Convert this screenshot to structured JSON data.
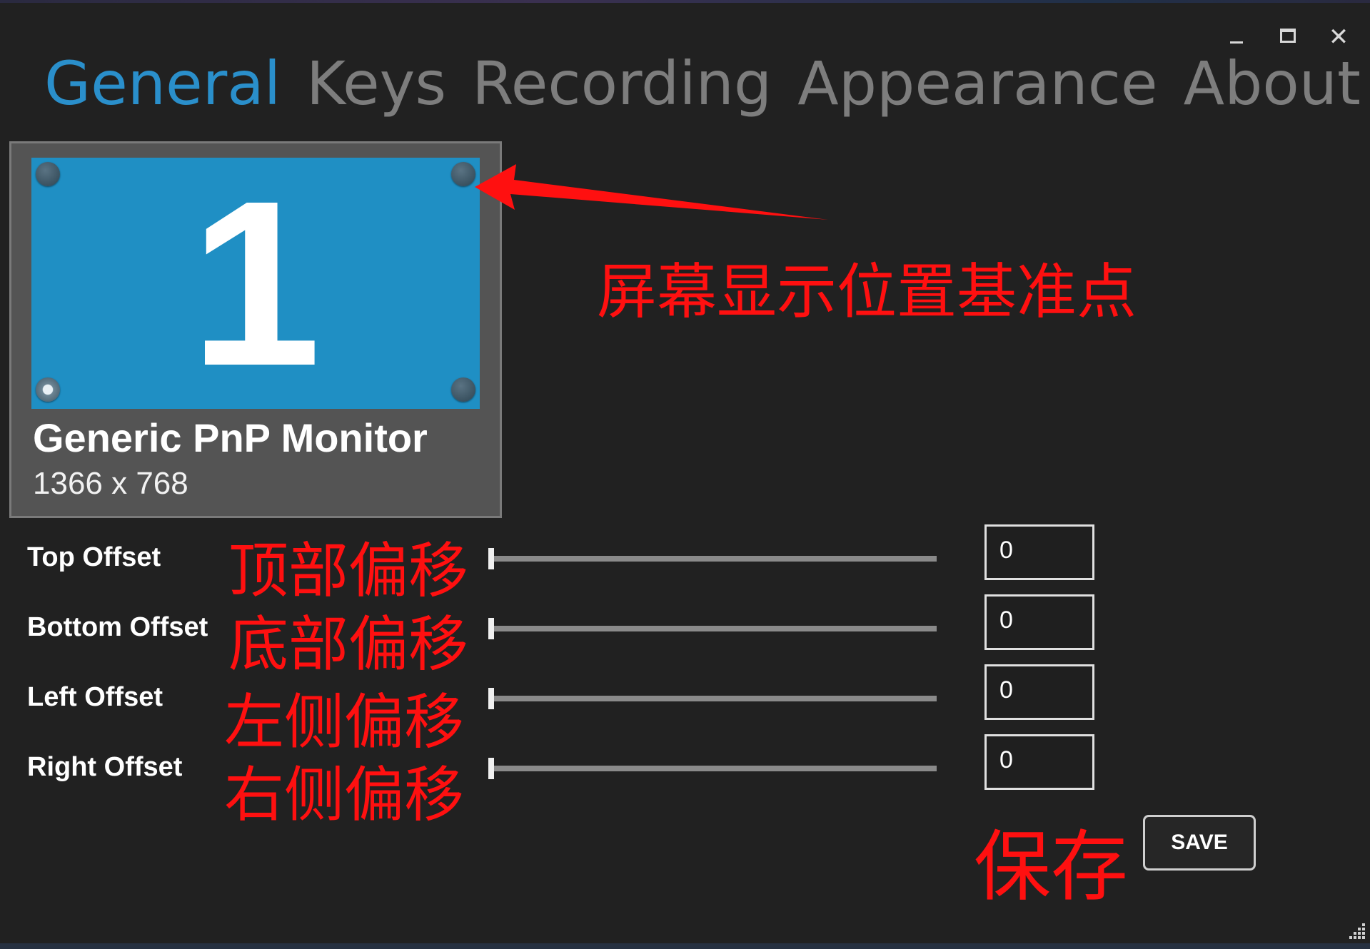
{
  "window": {
    "controls": [
      "minimize-icon",
      "maximize-icon",
      "close-icon"
    ],
    "close_glyph": "✕"
  },
  "tabs": [
    {
      "label": "General",
      "active": true
    },
    {
      "label": "Keys",
      "active": false
    },
    {
      "label": "Recording",
      "active": false
    },
    {
      "label": "Appearance",
      "active": false
    },
    {
      "label": "About",
      "active": false
    }
  ],
  "monitor": {
    "number": "1",
    "name": "Generic PnP Monitor",
    "resolution": "1366 x 768",
    "selected_anchor": "bottom-left"
  },
  "offsets": [
    {
      "label": "Top Offset",
      "value": "0",
      "annotation": "顶部偏移"
    },
    {
      "label": "Bottom Offset",
      "value": "0",
      "annotation": "底部偏移"
    },
    {
      "label": "Left Offset",
      "value": "0",
      "annotation": "左侧偏移"
    },
    {
      "label": "Right Offset",
      "value": "0",
      "annotation": "右侧偏移"
    }
  ],
  "annotations": {
    "anchor_note": "屏幕显示位置基准点",
    "save_note": "保存"
  },
  "save_label": "SAVE",
  "colors": {
    "background": "#212121",
    "accent": "#2a8fcb",
    "monitor_screen": "#1f8fc4",
    "annotation": "#ff1010"
  }
}
